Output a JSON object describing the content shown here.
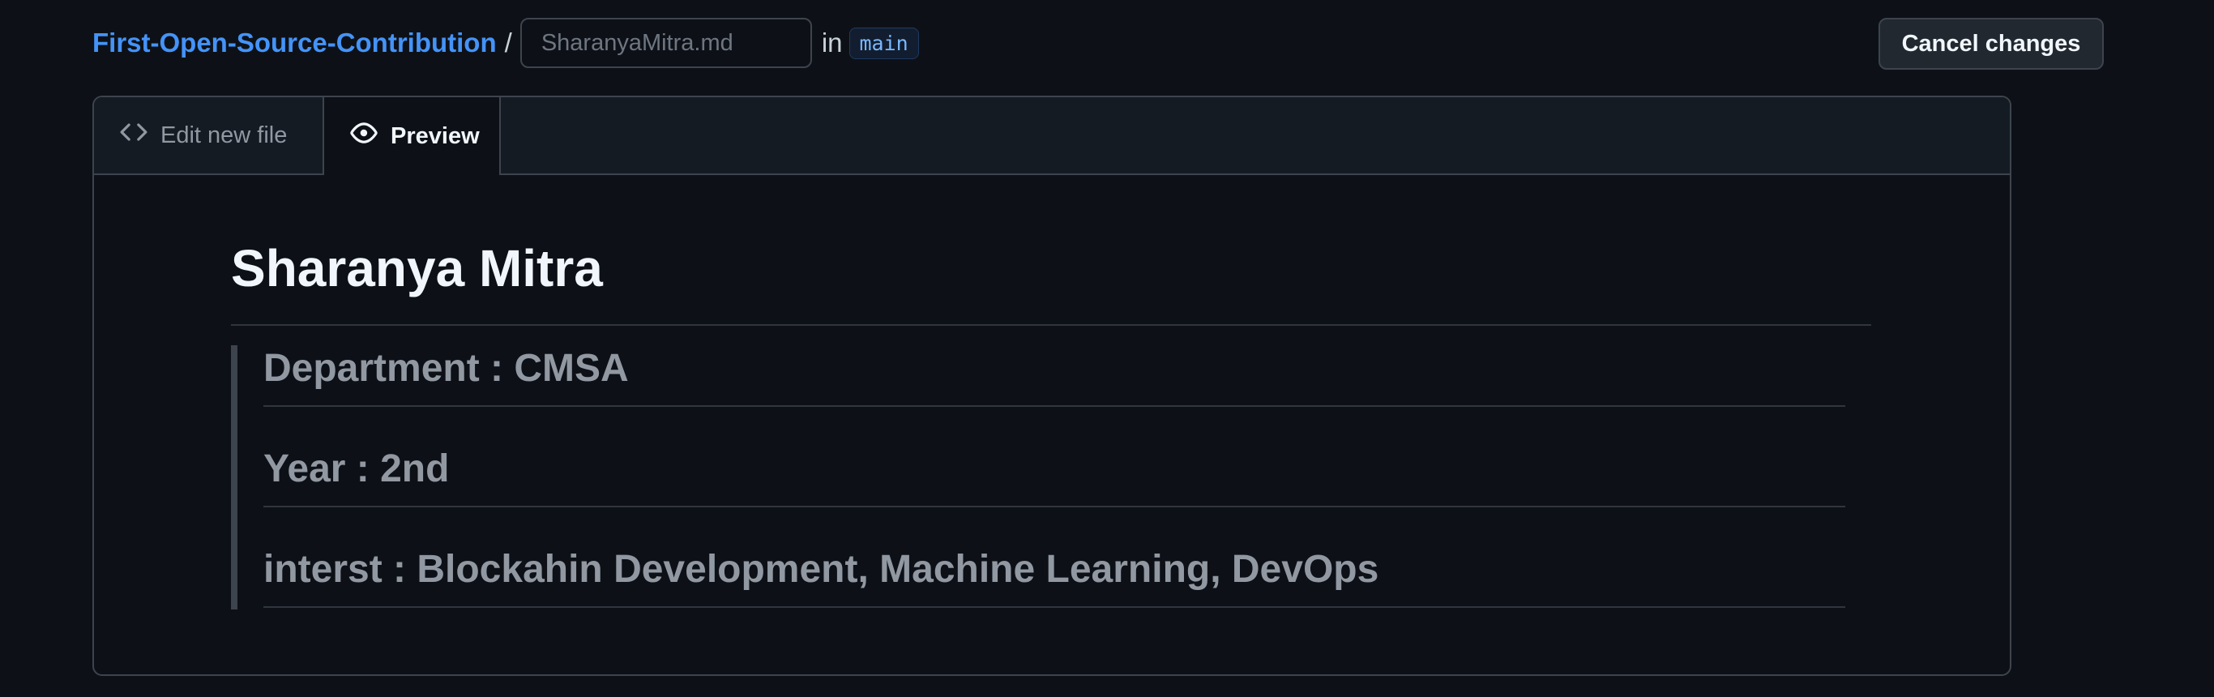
{
  "breadcrumb": {
    "repo": "First-Open-Source-Contribution",
    "separator": "/",
    "filename_placeholder": "SharanyaMitra.md",
    "filename_value": "",
    "in_label": "in",
    "branch": "main"
  },
  "actions": {
    "cancel_label": "Cancel changes"
  },
  "tabs": [
    {
      "label": "Edit new file",
      "icon": "code-icon",
      "active": false
    },
    {
      "label": "Preview",
      "icon": "eye-icon",
      "active": true
    }
  ],
  "preview": {
    "heading": "Sharanya Mitra",
    "blockquote": [
      "Department : CMSA",
      "Year : 2nd",
      "interst : Blockahin Development, Machine Learning, DevOps"
    ]
  },
  "colors": {
    "background": "#0d1117",
    "link": "#4493f8",
    "border": "#3d444d",
    "muted_text": "#9198a1"
  }
}
